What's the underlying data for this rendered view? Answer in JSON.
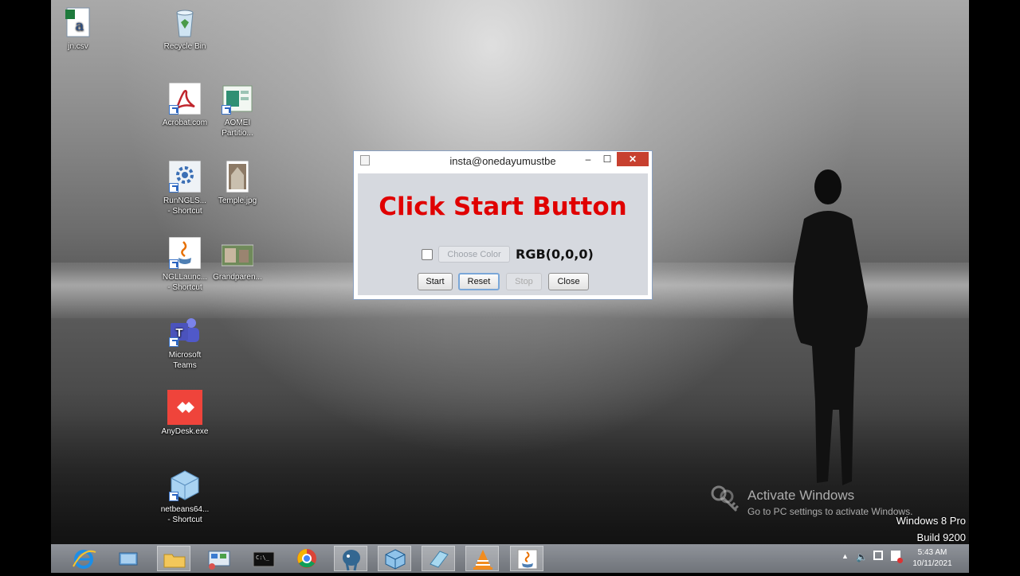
{
  "desktop": {
    "icons": [
      {
        "label": "jn.csv",
        "icon": "excel-csv-icon"
      },
      {
        "label": "Recycle Bin",
        "icon": "recycle-bin-icon"
      },
      {
        "label": "Acrobat.com",
        "icon": "acrobat-icon"
      },
      {
        "label": "AOMEI Partitio...",
        "icon": "aomei-partition-icon"
      },
      {
        "label": "RunNGLS... - Shortcut",
        "icon": "gear-shortcut-icon"
      },
      {
        "label": "Temple.jpg",
        "icon": "image-file-icon"
      },
      {
        "label": "NGLLaunc... - Shortcut",
        "icon": "java-icon"
      },
      {
        "label": "Grandparen...",
        "icon": "image-file-icon"
      },
      {
        "label": "Microsoft Teams",
        "icon": "teams-icon"
      },
      {
        "label": "AnyDesk.exe",
        "icon": "anydesk-icon"
      },
      {
        "label": "netbeans64... - Shortcut",
        "icon": "netbeans-icon"
      }
    ]
  },
  "window": {
    "title": "insta@onedayumustbe",
    "min_glyph": "–",
    "max_glyph": "☐",
    "close_glyph": "✕",
    "headline": "Click Start Button",
    "choose_color_label": "Choose Color",
    "rgb_text": "RGB(0,0,0)",
    "checkbox_checked": false,
    "buttons": {
      "start": "Start",
      "reset": "Reset",
      "stop": "Stop",
      "close": "Close"
    }
  },
  "watermark": {
    "line1": "Activate Windows",
    "line2": "Go to PC settings to activate Windows."
  },
  "os_version": {
    "line1": "Windows 8 Pro",
    "line2": "Build 9200"
  },
  "taskbar": {
    "items": [
      "internet-explorer-icon",
      "file-explorer-icon",
      "folder-icon",
      "control-panel-icon",
      "command-prompt-icon",
      "chrome-icon",
      "postgresql-icon",
      "virtualbox-icon",
      "notepad-icon",
      "vlc-icon",
      "java-icon"
    ],
    "active_item": "java-icon"
  },
  "tray": {
    "icons": [
      "show-hidden-icon",
      "volume-icon",
      "network-icon",
      "action-center-icon"
    ]
  },
  "clock": {
    "time": "5:43 AM",
    "date": "10/11/2021"
  },
  "colors": {
    "headline": "#e00000",
    "close_button": "#c7402f",
    "dialog_bg": "#d6d9df"
  }
}
